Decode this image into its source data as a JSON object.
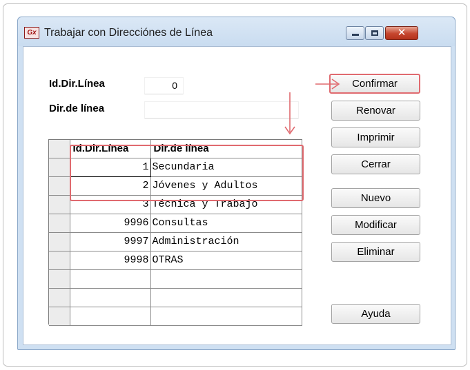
{
  "window": {
    "icon_text": "Gx",
    "title": "Trabajar con Direcciónes de Línea",
    "controls": {
      "close_glyph": "✕"
    }
  },
  "form": {
    "id_label": "Id.Dir.Línea",
    "id_value": "0",
    "dir_label": "Dir.de línea",
    "dir_value": ""
  },
  "grid": {
    "headers": [
      "Id.Dir.Línea",
      "Dir.de línea"
    ],
    "rows": [
      {
        "id": "1",
        "name": "Secundaria"
      },
      {
        "id": "2",
        "name": "Jóvenes y Adultos"
      },
      {
        "id": "3",
        "name": "Técnica y Trabajo"
      },
      {
        "id": "9996",
        "name": "Consultas"
      },
      {
        "id": "9997",
        "name": "Administración"
      },
      {
        "id": "9998",
        "name": "OTRAS"
      },
      {
        "id": "",
        "name": ""
      },
      {
        "id": "",
        "name": ""
      },
      {
        "id": "",
        "name": ""
      }
    ]
  },
  "buttons": {
    "confirmar": "Confirmar",
    "renovar": "Renovar",
    "imprimir": "Imprimir",
    "cerrar": "Cerrar",
    "nuevo": "Nuevo",
    "modificar": "Modificar",
    "eliminar": "Eliminar",
    "ayuda": "Ayuda"
  },
  "annotation_color": "#e06a6f"
}
